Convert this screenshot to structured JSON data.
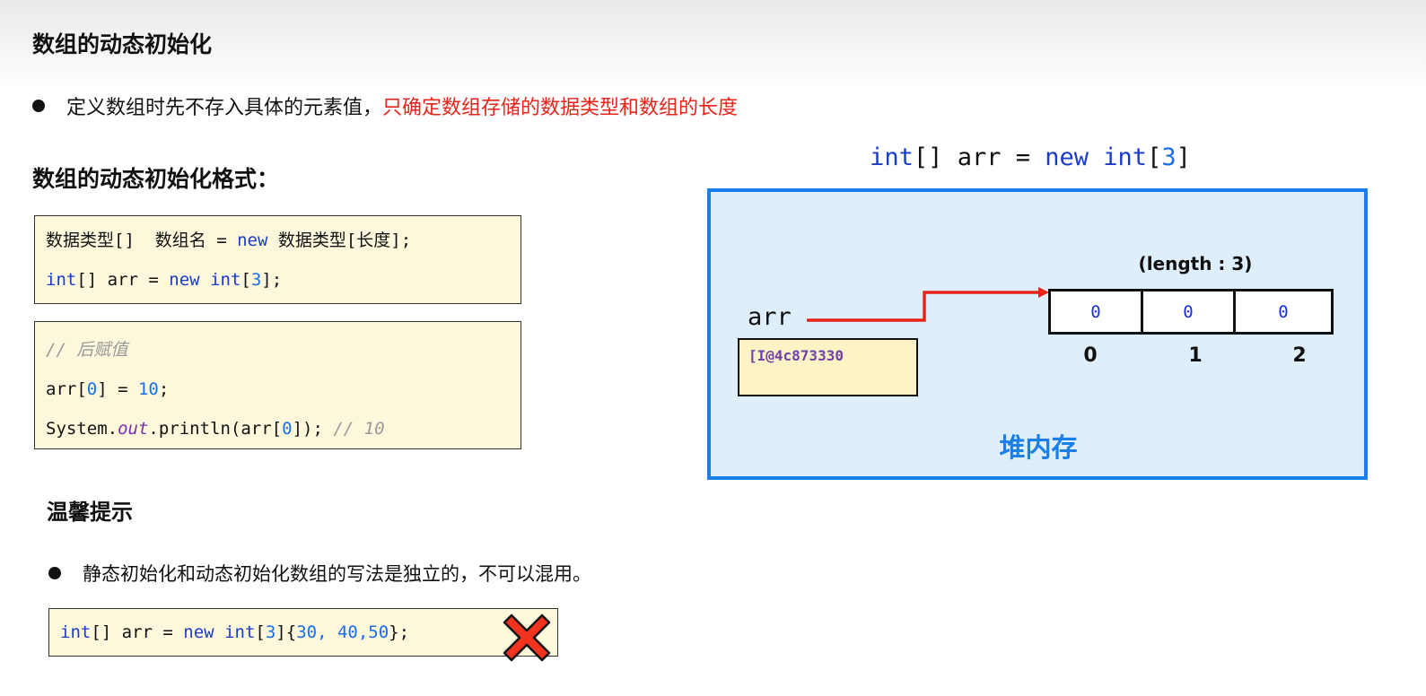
{
  "title": "数组的动态初始化",
  "bullet1": {
    "normal": "定义数组时先不存入具体的元素值，",
    "highlight": "只确定数组存储的数据类型和数组的长度"
  },
  "format_heading": "数组的动态初始化格式：",
  "code_box1": [
    [
      [
        "t",
        "数据类型[]  数组名 = "
      ],
      [
        "kw",
        "new"
      ],
      [
        "t",
        " 数据类型[长度];"
      ]
    ],
    [
      [
        "kw",
        "int"
      ],
      [
        "t",
        "[] arr = "
      ],
      [
        "kw",
        "new"
      ],
      [
        "t",
        " "
      ],
      [
        "kw",
        "int"
      ],
      [
        "t",
        "["
      ],
      [
        "num",
        "3"
      ],
      [
        "t",
        "];"
      ]
    ]
  ],
  "code_box2": [
    [
      [
        "cm",
        "// 后赋值"
      ]
    ],
    [
      [
        "t",
        "arr["
      ],
      [
        "num",
        "0"
      ],
      [
        "t",
        "] = "
      ],
      [
        "num",
        "10"
      ],
      [
        "t",
        ";"
      ]
    ],
    [
      [
        "t",
        "System."
      ],
      [
        "it",
        "out"
      ],
      [
        "t",
        ".println(arr["
      ],
      [
        "num",
        "0"
      ],
      [
        "t",
        "]); "
      ],
      [
        "cm",
        "// 10"
      ]
    ]
  ],
  "tip_heading": "温馨提示",
  "bullet2": "静态初始化和动态初始化数组的写法是独立的，不可以混用。",
  "code_box3": [
    [
      [
        "kw",
        "int"
      ],
      [
        "t",
        "[] arr = "
      ],
      [
        "kw",
        "new"
      ],
      [
        "t",
        " "
      ],
      [
        "kw",
        "int"
      ],
      [
        "t",
        "["
      ],
      [
        "num",
        "3"
      ],
      [
        "t",
        "]{"
      ],
      [
        "num",
        "30, 40,50"
      ],
      [
        "t",
        "};"
      ]
    ]
  ],
  "wrong_icon": "red-x-icon",
  "diagram": {
    "heading": [
      [
        "kw",
        "int"
      ],
      [
        "t",
        "[] arr = "
      ],
      [
        "kw",
        "new"
      ],
      [
        "t",
        " "
      ],
      [
        "kw",
        "int"
      ],
      [
        "t",
        "["
      ],
      [
        "num",
        "3"
      ],
      [
        "t",
        "]"
      ]
    ],
    "var_name": "arr",
    "address": "[I@4c873330",
    "length_label": "(length : 3)",
    "cells": [
      "0",
      "0",
      "0"
    ],
    "indices": [
      "0",
      "1",
      "2"
    ],
    "heap_label": "堆内存",
    "colors": {
      "border": "#1a7fe8",
      "arrow": "#e8231a",
      "address": "#7040a8"
    }
  }
}
